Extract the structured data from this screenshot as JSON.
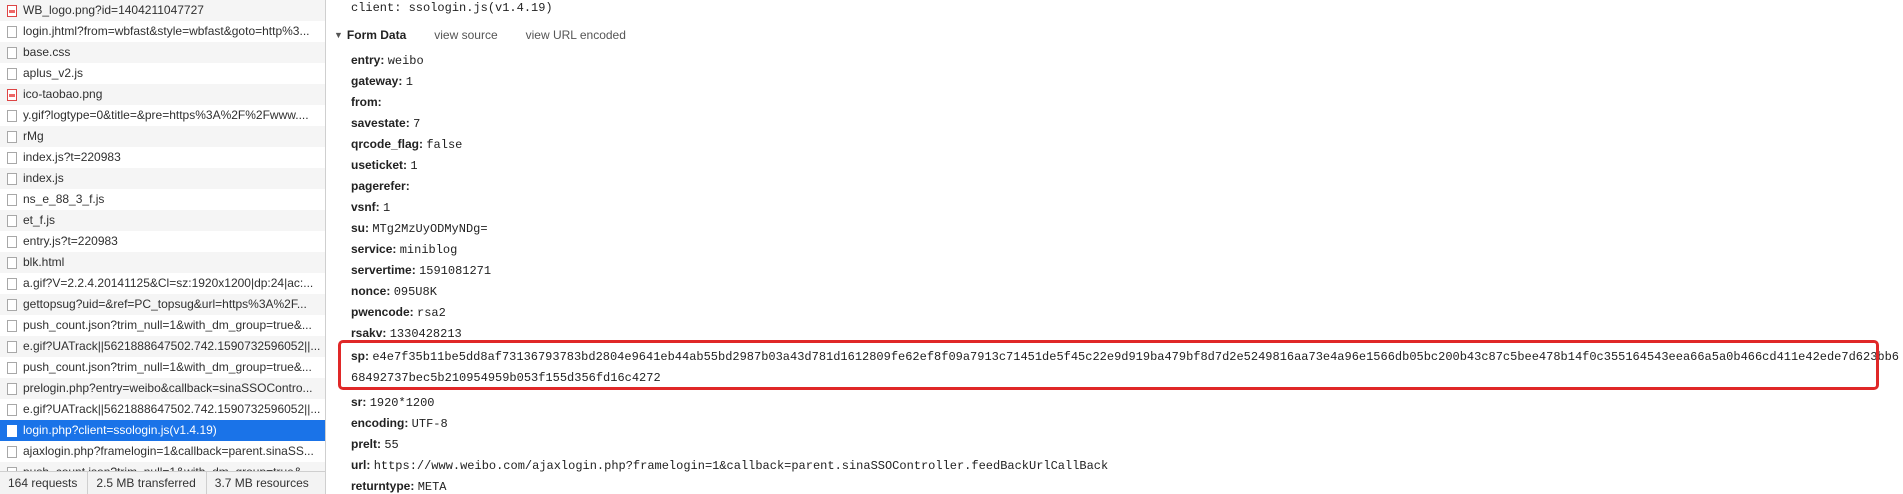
{
  "requests": [
    {
      "name": "WB_logo.png?id=1404211047727",
      "type": "image"
    },
    {
      "name": "login.jhtml?from=wbfast&style=wbfast&goto=http%3...",
      "type": "doc"
    },
    {
      "name": "base.css",
      "type": "doc"
    },
    {
      "name": "aplus_v2.js",
      "type": "doc"
    },
    {
      "name": "ico-taobao.png",
      "type": "image"
    },
    {
      "name": "y.gif?logtype=0&title=&pre=https%3A%2F%2Fwww....",
      "type": "doc"
    },
    {
      "name": "rMg",
      "type": "doc"
    },
    {
      "name": "index.js?t=220983",
      "type": "doc"
    },
    {
      "name": "index.js",
      "type": "doc"
    },
    {
      "name": "ns_e_88_3_f.js",
      "type": "doc"
    },
    {
      "name": "et_f.js",
      "type": "doc"
    },
    {
      "name": "entry.js?t=220983",
      "type": "doc"
    },
    {
      "name": "blk.html",
      "type": "doc"
    },
    {
      "name": "a.gif?V=2.2.4.20141125&Cl=sz:1920x1200|dp:24|ac:...",
      "type": "doc"
    },
    {
      "name": "gettopsug?uid=&ref=PC_topsug&url=https%3A%2F...",
      "type": "doc"
    },
    {
      "name": "push_count.json?trim_null=1&with_dm_group=true&...",
      "type": "doc"
    },
    {
      "name": "e.gif?UATrack||5621888647502.742.1590732596052||...",
      "type": "doc"
    },
    {
      "name": "push_count.json?trim_null=1&with_dm_group=true&...",
      "type": "doc"
    },
    {
      "name": "prelogin.php?entry=weibo&callback=sinaSSOContro...",
      "type": "doc"
    },
    {
      "name": "e.gif?UATrack||5621888647502.742.1590732596052||...",
      "type": "doc"
    },
    {
      "name": "login.php?client=ssologin.js(v1.4.19)",
      "type": "doc",
      "selected": true
    },
    {
      "name": "ajaxlogin.php?framelogin=1&callback=parent.sinaSS...",
      "type": "doc"
    },
    {
      "name": "push_count.json?trim_null=1&with_dm_group=true&...",
      "type": "doc"
    }
  ],
  "status": {
    "requests": "164 requests",
    "transferred": "2.5 MB transferred",
    "resources": "3.7 MB resources"
  },
  "top_line": "client: ssologin.js(v1.4.19)",
  "section": {
    "title": "Form Data",
    "view_source": "view source",
    "view_url": "view URL encoded"
  },
  "fields_a": [
    {
      "k": "entry:",
      "v": "weibo"
    },
    {
      "k": "gateway:",
      "v": "1"
    },
    {
      "k": "from:",
      "v": ""
    },
    {
      "k": "savestate:",
      "v": "7"
    },
    {
      "k": "qrcode_flag:",
      "v": "false"
    },
    {
      "k": "useticket:",
      "v": "1"
    },
    {
      "k": "pagerefer:",
      "v": ""
    },
    {
      "k": "vsnf:",
      "v": "1"
    },
    {
      "k": "su:",
      "v": "MTg2MzUyODMyNDg="
    },
    {
      "k": "service:",
      "v": "miniblog"
    },
    {
      "k": "servertime:",
      "v": "1591081271"
    },
    {
      "k": "nonce:",
      "v": "095U8K"
    },
    {
      "k": "pwencode:",
      "v": "rsa2"
    },
    {
      "k": "rsakv:",
      "v": "1330428213"
    }
  ],
  "sp": {
    "k": "sp:",
    "v": "e4e7f35b11be5dd8af73136793783bd2804e9641eb44ab55bd2987b03a43d781d1612809fe62ef8f09a7913c71451de5f45c22e9d919ba479bf8d7d2e5249816aa73e4a96e1566db05bc200b43c87c5bee478b14f0c355164543eea66a5a0b466cd411e42ede7d623bb668492737bec5b210954959b053f155d356fd16c4272"
  },
  "fields_b": [
    {
      "k": "sr:",
      "v": "1920*1200"
    },
    {
      "k": "encoding:",
      "v": "UTF-8"
    },
    {
      "k": "prelt:",
      "v": "55"
    },
    {
      "k": "url:",
      "v": "https://www.weibo.com/ajaxlogin.php?framelogin=1&callback=parent.sinaSSOController.feedBackUrlCallBack"
    },
    {
      "k": "returntype:",
      "v": "META"
    }
  ],
  "colors": {
    "selected": "#1a73e8",
    "highlight": "#e02828"
  }
}
